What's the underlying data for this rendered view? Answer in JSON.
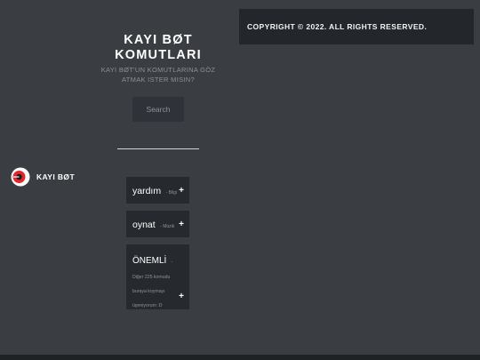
{
  "header": {
    "title_line1": "KAYI BØT",
    "title_line2": "KOMUTLARI",
    "subtitle_line1": "KAYI BØT'UN KOMUTLARINA GÖZ",
    "subtitle_line2": "ATMAK ISTER MISIN?"
  },
  "search": {
    "placeholder": "Search",
    "value": ""
  },
  "footer": {
    "copyright": "COPYRIGHT © 2022. ALL RIGHTS RESERVED."
  },
  "bot": {
    "name": "KAYI BØT",
    "logo_icon": "red-circle-logo-icon",
    "accent": "#e0262e"
  },
  "commands": [
    {
      "name": "yardım",
      "category": "- Bilgi",
      "expand": "+"
    },
    {
      "name": "oynat",
      "category": "- Müzik",
      "expand": "+"
    },
    {
      "name": "ÖNEMLİ",
      "category": "-",
      "description_lines": [
        "Diğer 225 komudu",
        "buraya koymayı",
        "üşeniyorum :D"
      ],
      "expand": "+"
    }
  ]
}
